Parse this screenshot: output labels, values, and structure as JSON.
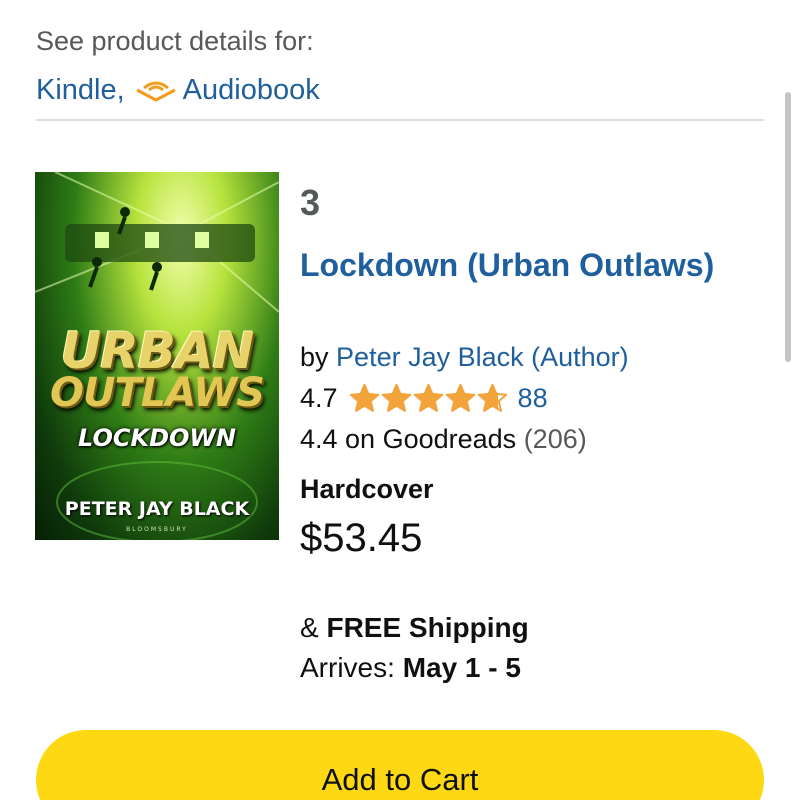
{
  "details": {
    "header": "See product details for:",
    "formats": [
      "Kindle,",
      "Audiobook"
    ]
  },
  "cover": {
    "line1": "URBAN",
    "line2": "OUTLAWS",
    "subtitle": "LOCKDOWN",
    "author": "PETER JAY BLACK",
    "publisher": "BLOOMSBURY"
  },
  "product": {
    "series_number": "3",
    "title": "Lockdown (Urban Outlaws)",
    "by_prefix": "by",
    "author": "Peter Jay Black (Author)",
    "rating": "4.7",
    "rating_stars": 4.7,
    "review_count": "88",
    "goodreads_text": "4.4 on Goodreads",
    "goodreads_count": "(206)",
    "format": "Hardcover",
    "price": "$53.45",
    "shipping_prefix": "&",
    "shipping": "FREE Shipping",
    "arrives_label": "Arrives:",
    "arrives_dates": "May 1 - 5"
  },
  "actions": {
    "add_to_cart": "Add to Cart"
  },
  "colors": {
    "link": "#1f5f9e",
    "star": "#f2a33a",
    "cart_button": "#ffd814"
  }
}
